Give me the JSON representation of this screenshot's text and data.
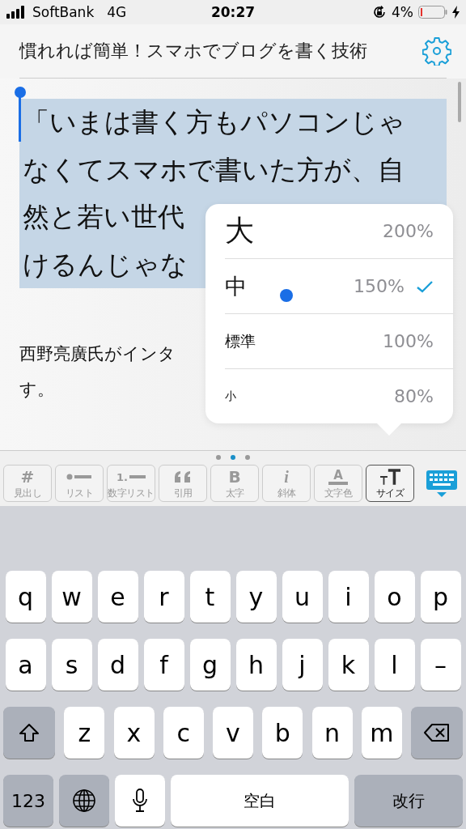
{
  "status_bar": {
    "carrier": "SoftBank",
    "network": "4G",
    "time": "20:27",
    "battery": "4%"
  },
  "header": {
    "title": "慣れれば簡単！スマホでブログを書く技術"
  },
  "editor": {
    "selected_lines": [
      "「いまは書く方もパソコンじゃ",
      "なくてスマホで書いた方が、自",
      "然と若い世代",
      "けるんじゃな"
    ],
    "paragraph_lines": [
      "西野亮廣氏がインタ",
      "す。"
    ]
  },
  "size_menu": {
    "options": [
      {
        "label": "大",
        "kind": "large",
        "percent": "200%",
        "selected": false
      },
      {
        "label": "中",
        "kind": "medium",
        "percent": "150%",
        "selected": true
      },
      {
        "label": "標準",
        "kind": "normal",
        "percent": "100%",
        "selected": false
      },
      {
        "label": "小",
        "kind": "small",
        "percent": "80%",
        "selected": false
      }
    ]
  },
  "page_dots": [
    {
      "selected": false
    },
    {
      "selected": true
    },
    {
      "selected": false
    }
  ],
  "toolbar": [
    {
      "kind": "heading",
      "symbol": "#",
      "label": "見出し",
      "selected": false
    },
    {
      "kind": "list",
      "label": "リスト",
      "selected": false
    },
    {
      "kind": "numbered",
      "symbol": "1.",
      "label": "数字リスト",
      "selected": false
    },
    {
      "kind": "quote",
      "label": "引用",
      "selected": false
    },
    {
      "kind": "bold",
      "symbol": "B",
      "label": "太字",
      "selected": false
    },
    {
      "kind": "italic",
      "symbol": "i",
      "label": "斜体",
      "selected": false
    },
    {
      "kind": "color",
      "symbol": "A",
      "label": "文字色",
      "selected": false
    },
    {
      "kind": "size",
      "label": "サイズ",
      "selected": true
    }
  ],
  "keyboard": {
    "rows": [
      [
        {
          "kind": "letter",
          "label": "q"
        },
        {
          "kind": "letter",
          "label": "w"
        },
        {
          "kind": "letter",
          "label": "e"
        },
        {
          "kind": "letter",
          "label": "r"
        },
        {
          "kind": "letter",
          "label": "t"
        },
        {
          "kind": "letter",
          "label": "y"
        },
        {
          "kind": "letter",
          "label": "u"
        },
        {
          "kind": "letter",
          "label": "i"
        },
        {
          "kind": "letter",
          "label": "o"
        },
        {
          "kind": "letter",
          "label": "p"
        }
      ],
      [
        {
          "kind": "letter",
          "label": "a"
        },
        {
          "kind": "letter",
          "label": "s"
        },
        {
          "kind": "letter",
          "label": "d"
        },
        {
          "kind": "letter",
          "label": "f"
        },
        {
          "kind": "letter",
          "label": "g"
        },
        {
          "kind": "letter",
          "label": "h"
        },
        {
          "kind": "letter",
          "label": "j"
        },
        {
          "kind": "letter",
          "label": "k"
        },
        {
          "kind": "letter",
          "label": "l"
        },
        {
          "kind": "letter",
          "label": "–"
        }
      ],
      [
        {
          "kind": "shift"
        },
        {
          "kind": "letter",
          "label": "z"
        },
        {
          "kind": "letter",
          "label": "x"
        },
        {
          "kind": "letter",
          "label": "c"
        },
        {
          "kind": "letter",
          "label": "v"
        },
        {
          "kind": "letter",
          "label": "b"
        },
        {
          "kind": "letter",
          "label": "n"
        },
        {
          "kind": "letter",
          "label": "m"
        },
        {
          "kind": "delete"
        }
      ]
    ],
    "bottom_row": [
      {
        "kind": "mode",
        "label": "123"
      },
      {
        "kind": "globe"
      },
      {
        "kind": "mic"
      },
      {
        "kind": "space",
        "label": "空白"
      },
      {
        "kind": "return",
        "label": "改行"
      }
    ]
  }
}
